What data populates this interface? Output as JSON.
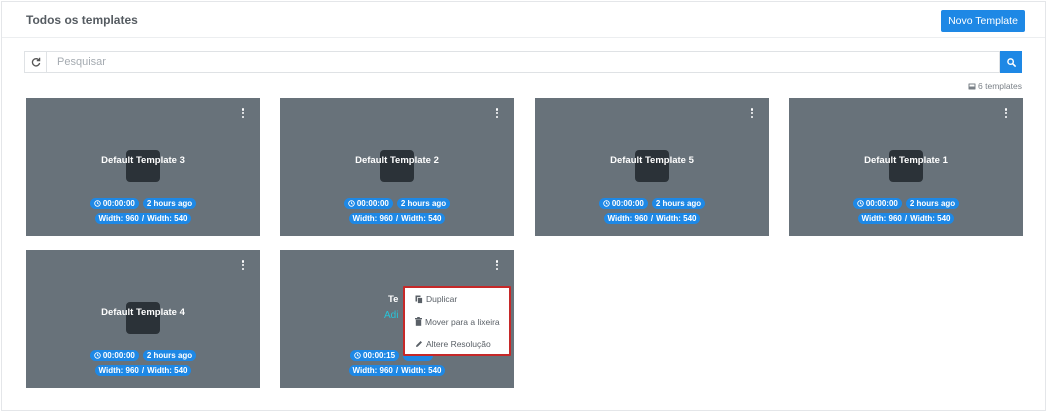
{
  "header": {
    "title": "Todos os templates",
    "new_button": "Novo Template"
  },
  "search": {
    "placeholder": "Pesquisar",
    "value": ""
  },
  "template_count": "6 templates",
  "cards": [
    {
      "title": "Default Template 3",
      "duration": "00:00:00",
      "time_ago": "2 hours ago",
      "width_label": "Width: 960",
      "separator": "/",
      "height_label": "Width: 540"
    },
    {
      "title": "Default Template 2",
      "duration": "00:00:00",
      "time_ago": "2 hours ago",
      "width_label": "Width: 960",
      "separator": "/",
      "height_label": "Width: 540"
    },
    {
      "title": "Default Template 5",
      "duration": "00:00:00",
      "time_ago": "2 hours ago",
      "width_label": "Width: 960",
      "separator": "/",
      "height_label": "Width: 540"
    },
    {
      "title": "Default Template 1",
      "duration": "00:00:00",
      "time_ago": "2 hours ago",
      "width_label": "Width: 960",
      "separator": "/",
      "height_label": "Width: 540"
    },
    {
      "title": "Default Template 4",
      "duration": "00:00:00",
      "time_ago": "2 hours ago",
      "width_label": "Width: 960",
      "separator": "/",
      "height_label": "Width: 540"
    },
    {
      "title": "Te",
      "subtitle": "Adi",
      "duration": "00:00:15",
      "time_ago": "",
      "width_label": "Width: 960",
      "separator": "/",
      "height_label": "Width: 540"
    }
  ],
  "context_menu": {
    "items": [
      {
        "label": "Duplicar",
        "icon": "copy-icon"
      },
      {
        "label": "Mover para a lixeira",
        "icon": "trash-icon"
      },
      {
        "label": "Altere Resolução",
        "icon": "pencil-icon"
      }
    ]
  },
  "colors": {
    "accent": "#1e88e5",
    "card_bg": "#68727a",
    "menu_border": "#c62828"
  }
}
